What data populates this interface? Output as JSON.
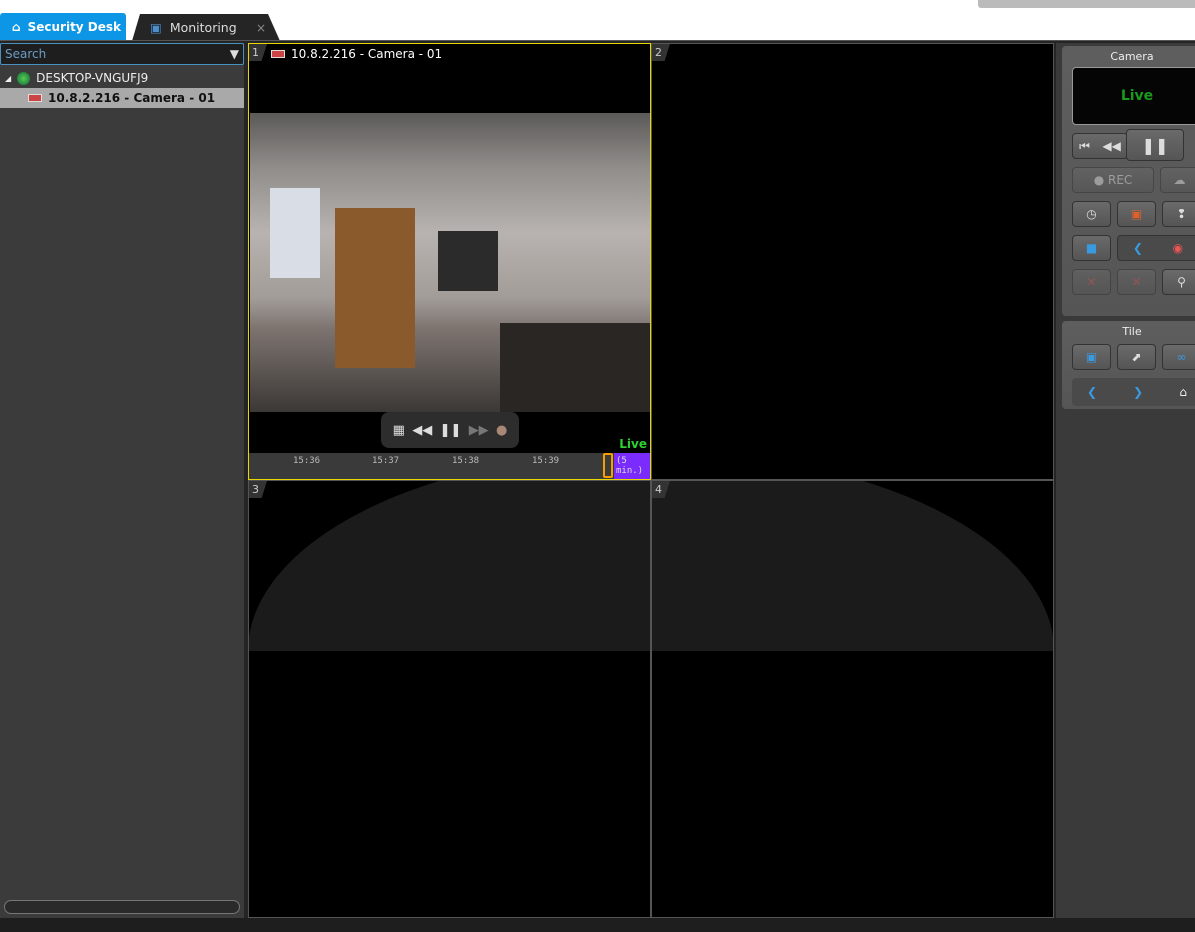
{
  "tabs": [
    {
      "label": "Security Desk",
      "icon": "home-icon",
      "active": true
    },
    {
      "label": "Monitoring",
      "icon": "monitoring-icon",
      "close": "×"
    }
  ],
  "sidebar": {
    "search_placeholder": "Search",
    "tree": [
      {
        "label": "DESKTOP-VNGUFJ9",
        "icon": "globe-icon",
        "expander": "◢"
      },
      {
        "label": "10.8.2.216 - Camera - 01",
        "icon": "camera-icon",
        "selected": true
      }
    ]
  },
  "tiles": [
    {
      "num": "1",
      "title": "10.8.2.216 - Camera - 01",
      "live": "Live",
      "timeline": {
        "ticks": [
          "15:36",
          "15:37",
          "15:38",
          "15:39"
        ],
        "range": "(5 min.)"
      }
    },
    {
      "num": "2"
    },
    {
      "num": "3"
    },
    {
      "num": "4"
    }
  ],
  "camera_panel": {
    "title": "Camera",
    "status": "Live",
    "rec": "REC"
  },
  "tile_panel": {
    "title": "Tile"
  },
  "colors": {
    "accent": "#0d96e6",
    "live": "#2fd12f",
    "selection": "#e6d800",
    "timeline_range": "#7a2cff"
  }
}
